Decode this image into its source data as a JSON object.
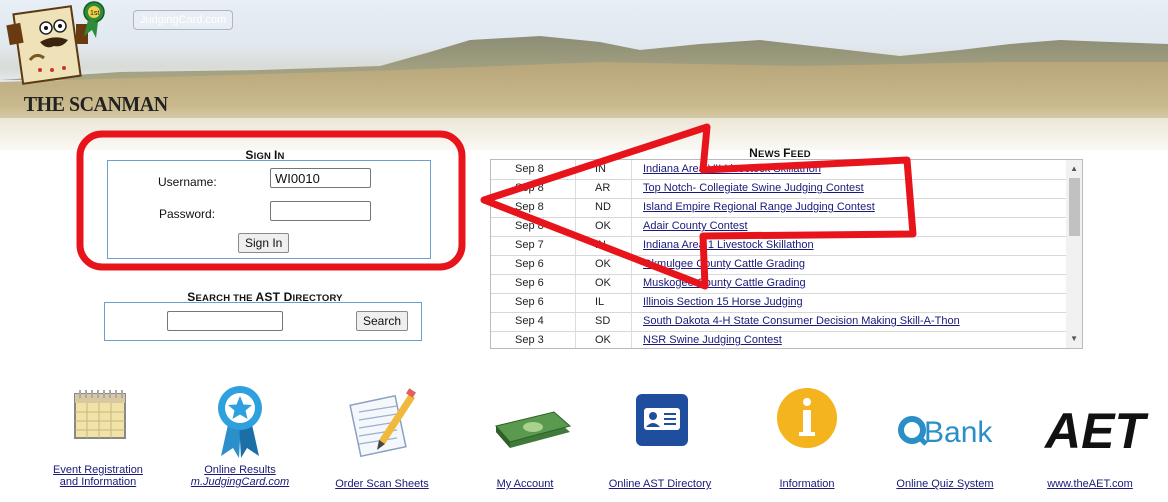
{
  "banner": {
    "badge": "JudgingCard.com",
    "logo_text": "THE SCANMAN",
    "logo_badge": "1st"
  },
  "signin": {
    "heading_first": "S",
    "heading_rest": "IGN ",
    "heading_second": "I",
    "heading_end": "N",
    "username_label": "Username:",
    "username_value": "WI0010",
    "password_label": "Password:",
    "password_value": "",
    "button_label": "Sign In"
  },
  "search": {
    "heading": [
      {
        "big": "S",
        "small": "EARCH THE "
      },
      {
        "big": "AST D",
        "small": "IRECTORY"
      }
    ],
    "input_value": "",
    "button_label": "Search"
  },
  "news": {
    "heading_big1": "N",
    "heading_small1": "EWS ",
    "heading_big2": "F",
    "heading_small2": "EED",
    "items": [
      {
        "date": "Sep 8",
        "state": "IN",
        "title": "Indiana Area VII Livestock Skillathon"
      },
      {
        "date": "Sep 8",
        "state": "AR",
        "title": "Top Notch- Collegiate Swine Judging Contest"
      },
      {
        "date": "Sep 8",
        "state": "ND",
        "title": "Island Empire Regional Range Judging Contest"
      },
      {
        "date": "Sep 8",
        "state": "OK",
        "title": "Adair County Contest"
      },
      {
        "date": "Sep 7",
        "state": "IN",
        "title": "Indiana Area 1 Livestock Skillathon"
      },
      {
        "date": "Sep 6",
        "state": "OK",
        "title": "Okmulgee County Cattle Grading"
      },
      {
        "date": "Sep 6",
        "state": "OK",
        "title": "Muskogee County Cattle Grading"
      },
      {
        "date": "Sep 6",
        "state": "IL",
        "title": "Illinois Section 15 Horse Judging"
      },
      {
        "date": "Sep 4",
        "state": "SD",
        "title": "South Dakota 4-H State Consumer Decision Making Skill-A-Thon"
      },
      {
        "date": "Sep 3",
        "state": "OK",
        "title": "NSR Swine Judging Contest"
      }
    ]
  },
  "tiles": [
    {
      "icon": "calendar-icon",
      "line1": "Event Registration",
      "line2": "and Information",
      "line2_italic": false
    },
    {
      "icon": "award-ribbon-icon",
      "line1": "Online Results",
      "line2": "m.JudgingCard.com",
      "line2_italic": true
    },
    {
      "icon": "scan-sheet-pencil-icon",
      "line1": "Order Scan Sheets",
      "line2": "",
      "line2_italic": false
    },
    {
      "icon": "money-stack-icon",
      "line1": "My Account",
      "line2": "",
      "line2_italic": false
    },
    {
      "icon": "contact-card-icon",
      "line1": "Online AST Directory",
      "line2": "",
      "line2_italic": false
    },
    {
      "icon": "info-icon",
      "line1": "Information",
      "line2": "",
      "line2_italic": false
    },
    {
      "icon": "qbank-logo-icon",
      "line1": "Online Quiz System",
      "line2": "",
      "line2_italic": false,
      "logo_text": "Bank"
    },
    {
      "icon": "aet-logo-icon",
      "line1": "www.theAET.com",
      "line2": "",
      "line2_italic": false,
      "logo_text": "AET"
    }
  ],
  "colors": {
    "annotation_red": "#e8141b",
    "box_border": "#6b9fcd",
    "link": "#1a1a7a"
  }
}
